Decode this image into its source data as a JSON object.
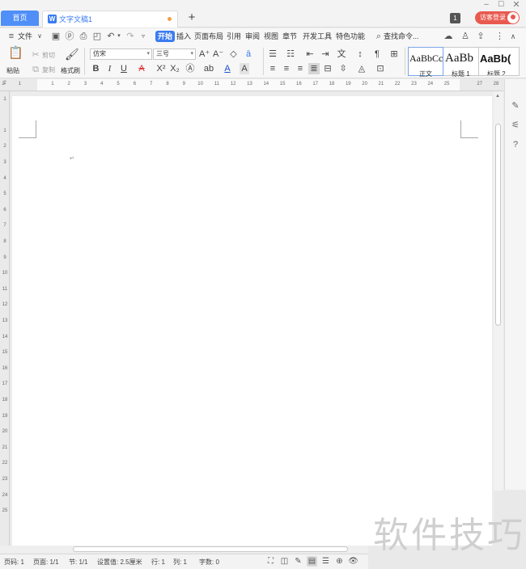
{
  "tabs": {
    "home": "首页",
    "doc": "文字文稿1",
    "add": "+"
  },
  "window": {
    "minimize": "–",
    "maximize": "☐",
    "close": "✕",
    "badge": "1",
    "guest": "访客登录"
  },
  "menu": {
    "file": "文件",
    "items": [
      "开始",
      "插入",
      "页面布局",
      "引用",
      "审阅",
      "视图",
      "章节",
      "开发工具",
      "特色功能"
    ],
    "search": "查找命令..."
  },
  "ribbon": {
    "paste": "粘贴",
    "cut": "剪切",
    "copy": "复制",
    "format_painter": "格式刷",
    "font_name": "仿宋",
    "font_size": "三号",
    "styles": [
      {
        "sample": "AaBbCc",
        "name": "正文"
      },
      {
        "sample": "AaBb",
        "name": "标题 1"
      },
      {
        "sample": "AaBb(",
        "name": "标题 2"
      }
    ]
  },
  "ruler": {
    "h": [
      "2",
      "1",
      "",
      "1",
      "2",
      "3",
      "4",
      "5",
      "6",
      "7",
      "8",
      "9",
      "10",
      "11",
      "12",
      "13",
      "14",
      "15",
      "16",
      "17",
      "18",
      "19",
      "20",
      "21",
      "22",
      "23",
      "24",
      "25",
      "",
      "27",
      "28"
    ],
    "v": [
      "2",
      "1",
      "",
      "1",
      "2",
      "3",
      "4",
      "5",
      "6",
      "7",
      "8",
      "9",
      "10",
      "11",
      "12",
      "13",
      "14",
      "15",
      "16",
      "17",
      "18",
      "19",
      "20",
      "21",
      "22",
      "23",
      "24",
      "25"
    ]
  },
  "document": {
    "para_mark": "↵"
  },
  "watermark": "软件技巧",
  "status": {
    "page_no": "页码: 1",
    "pages": "页面: 1/1",
    "section": "节: 1/1",
    "setting": "设置值: 2.5厘米",
    "row": "行: 1",
    "col": "列: 1",
    "words": "字数: 0"
  }
}
